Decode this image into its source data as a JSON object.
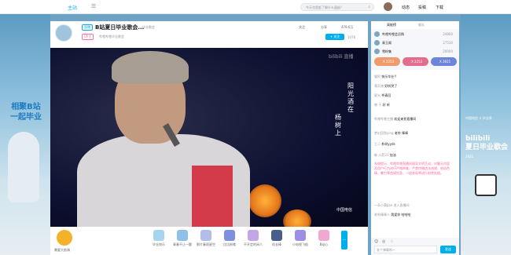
{
  "topnav": {
    "logo": "主站",
    "search_placeholder": "今天也是赶了解什么蛋糕？",
    "links": [
      "动态",
      "投稿",
      "下载"
    ]
  },
  "bg": {
    "slogan_left_1": "相聚B站",
    "slogan_left_2": "一起毕业",
    "brand_right": "中国电信 × 毕业季",
    "slogan_right_1": "bilibili",
    "slogan_right_2": "夏日毕业歌会",
    "slogan_right_sub": "2021"
  },
  "room": {
    "badge": "直播",
    "title": "B站夏日毕业歌会...",
    "area": "毕业歌会",
    "up_tag": "UP主",
    "uname": "哔哩哔哩毕业歌会",
    "actions": [
      "关注",
      "分享",
      "478.6万"
    ],
    "follow_label": "+ 关注",
    "fans": "1076"
  },
  "player": {
    "watermark": "bilibili 直播",
    "lyric_1": "阳光酒在",
    "lyric_2": "杨树上",
    "telecom": "中国电信"
  },
  "gifts": {
    "guard_label": "需要大航海",
    "items": [
      "毕业快乐",
      "青春不止一题",
      "那片春雨星空",
      "比比粉笔",
      "不开定的闲人",
      "机长棒",
      "小电视飞船",
      "B站心"
    ],
    "more": "⋯"
  },
  "side": {
    "tabs": [
      "高能榜",
      "舰队"
    ],
    "rank": [
      {
        "name": "哔哩哔哩会员购",
        "value": "24800"
      },
      {
        "name": "青玉阁",
        "value": "27530"
      },
      {
        "name": "雪岭集",
        "value": "20000"
      }
    ],
    "pills": [
      {
        "label": "X 2253"
      },
      {
        "label": "X 2253"
      },
      {
        "label": "X 3921"
      }
    ],
    "chat": [
      {
        "user": "猫阿",
        "msg": "快乐毕业!!"
      },
      {
        "user": "落天旅",
        "msg": "好听哭了"
      },
      {
        "user": "星光",
        "msg": "爷青回"
      },
      {
        "user": "晓 于",
        "msg": "好 听"
      },
      {
        "user": "哔哩哔哩主播",
        "msg": "欢迎来到直播间"
      },
      {
        "user": "梦幻回到ying",
        "msg": "老朴 棒棒"
      },
      {
        "user": "王二",
        "msg": "朴树yyds"
      },
      {
        "user": "新 火箭31",
        "msg": "加油"
      }
    ],
    "system_msg": "系统提示：哔哩哔哩直播间倡导文明互动，对聊天内容及用户行为进行严格审查，严禁传播违法违规、低俗色情、暴力等违规信息，一经发现将进行封禁处理。",
    "enter_msg": "一朵小葵Jian 进入直播间",
    "bottom_chat": {
      "user": "老朴棒棒人",
      "msg": "我爱你 哈哈哈"
    },
    "input_placeholder": "发个弹幕呗~",
    "send_label": "发送",
    "icons": [
      "☺",
      "◎",
      "♢"
    ]
  }
}
